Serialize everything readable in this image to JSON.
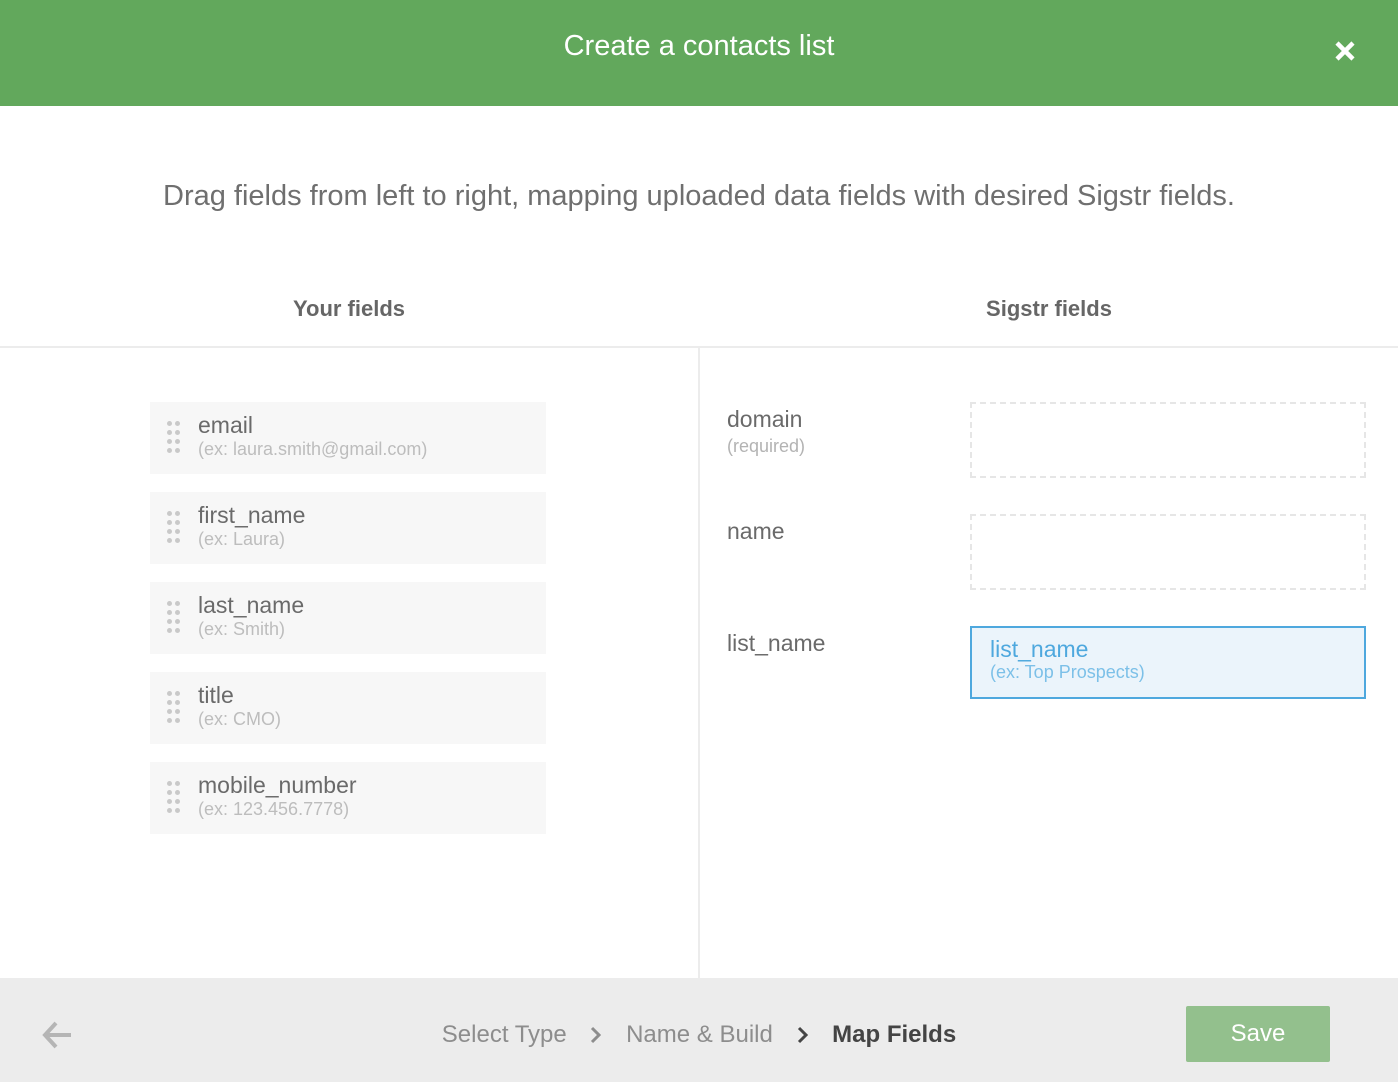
{
  "header": {
    "title": "Create a contacts list",
    "close_icon": "close-icon"
  },
  "instructions": "Drag fields from left to right, mapping uploaded data fields with desired Sigstr fields.",
  "columns": {
    "left_title": "Your fields",
    "right_title": "Sigstr fields"
  },
  "your_fields": [
    {
      "name": "email",
      "example": "(ex: laura.smith@gmail.com)"
    },
    {
      "name": "first_name",
      "example": "(ex: Laura)"
    },
    {
      "name": "last_name",
      "example": "(ex: Smith)"
    },
    {
      "name": "title",
      "example": "(ex: CMO)"
    },
    {
      "name": "mobile_number",
      "example": "(ex: 123.456.7778)"
    }
  ],
  "sigstr_fields": [
    {
      "label": "domain",
      "sublabel": "(required)",
      "mapped": null
    },
    {
      "label": "name",
      "sublabel": "",
      "mapped": null
    },
    {
      "label": "list_name",
      "sublabel": "",
      "mapped": {
        "name": "list_name",
        "example": "(ex: Top Prospects)"
      }
    }
  ],
  "footer": {
    "back_icon": "arrow-left-icon",
    "steps": [
      {
        "label": "Select Type",
        "active": false
      },
      {
        "label": "Name & Build",
        "active": false
      },
      {
        "label": "Map Fields",
        "active": true
      }
    ],
    "save_label": "Save"
  },
  "colors": {
    "header_bg": "#62a85c",
    "save_bg": "#93c08d",
    "mapped_accent": "#4ea8de"
  }
}
